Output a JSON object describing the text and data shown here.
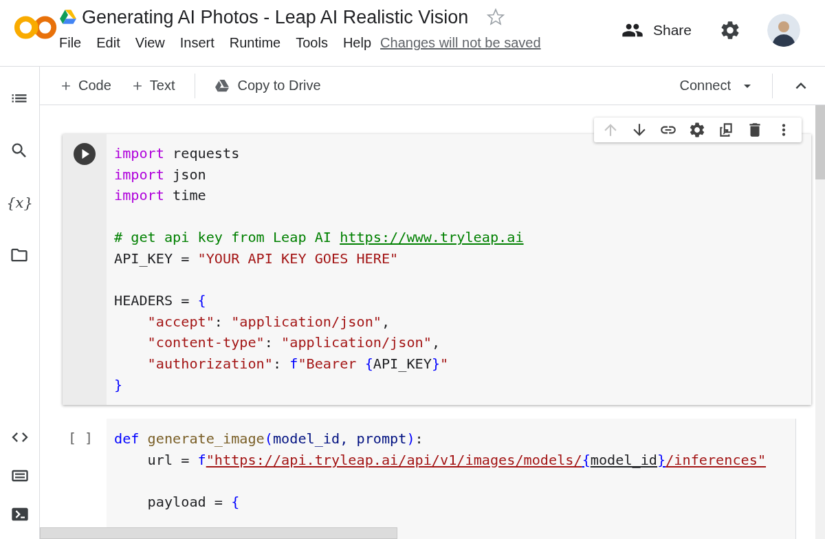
{
  "header": {
    "title": "Generating AI Photos - Leap AI Realistic Vision",
    "starred": false,
    "menu": [
      "File",
      "Edit",
      "View",
      "Insert",
      "Runtime",
      "Tools",
      "Help"
    ],
    "notice": "Changes will not be saved",
    "share": "Share"
  },
  "toolbar": {
    "add_code": "Code",
    "add_text": "Text",
    "copy": "Copy to Drive",
    "connect": "Connect"
  },
  "sidebar": {
    "top": [
      {
        "kind": "toc"
      },
      {
        "kind": "search"
      },
      {
        "kind": "variables",
        "glyph": "{x}"
      },
      {
        "kind": "files"
      }
    ],
    "bottom": [
      {
        "kind": "snippets"
      },
      {
        "kind": "palette"
      },
      {
        "kind": "terminal"
      }
    ]
  },
  "cell_toolbar": [
    {
      "kind": "up",
      "disabled": true
    },
    {
      "kind": "down",
      "disabled": false
    },
    {
      "kind": "link",
      "disabled": false
    },
    {
      "kind": "settings",
      "disabled": false
    },
    {
      "kind": "mirror",
      "disabled": false
    },
    {
      "kind": "delete",
      "disabled": false
    },
    {
      "kind": "more",
      "disabled": false
    }
  ],
  "cells": [
    {
      "focused": true,
      "lines": [
        {
          "tokens": [
            {
              "text": "import",
              "kind": "kw"
            },
            {
              "text": " requests",
              "kind": "plain"
            }
          ]
        },
        {
          "tokens": [
            {
              "text": "import",
              "kind": "kw"
            },
            {
              "text": " json",
              "kind": "plain"
            }
          ]
        },
        {
          "tokens": [
            {
              "text": "import",
              "kind": "kw"
            },
            {
              "text": " time",
              "kind": "plain"
            }
          ]
        },
        {
          "space_before": true,
          "tokens": [
            {
              "text": "# get api key from Leap AI ",
              "kind": "comment"
            },
            {
              "text": "https://www.tryleap.ai",
              "kind": "comment",
              "underlined": true
            }
          ]
        },
        {
          "tokens": [
            {
              "text": "API_KEY = ",
              "kind": "plain"
            },
            {
              "text": "\"YOUR API KEY GOES HERE\"",
              "kind": "str"
            }
          ]
        },
        {
          "space_before": true,
          "tokens": [
            {
              "text": "HEADERS = ",
              "kind": "plain"
            },
            {
              "text": "{",
              "kind": "blue"
            }
          ]
        },
        {
          "tokens": [
            {
              "text": "    \"accept\"",
              "kind": "str"
            },
            {
              "text": ": ",
              "kind": "plain"
            },
            {
              "text": "\"application/json\"",
              "kind": "str"
            },
            {
              "text": ",",
              "kind": "plain"
            }
          ]
        },
        {
          "tokens": [
            {
              "text": "    \"content-type\"",
              "kind": "str"
            },
            {
              "text": ": ",
              "kind": "plain"
            },
            {
              "text": "\"application/json\"",
              "kind": "str"
            },
            {
              "text": ",",
              "kind": "plain"
            }
          ]
        },
        {
          "tokens": [
            {
              "text": "    \"authorization\"",
              "kind": "str"
            },
            {
              "text": ": ",
              "kind": "plain"
            },
            {
              "text": "f",
              "kind": "blue"
            },
            {
              "text": "\"Bearer ",
              "kind": "str"
            },
            {
              "text": "{",
              "kind": "blue"
            },
            {
              "text": "API_KEY",
              "kind": "plain"
            },
            {
              "text": "}",
              "kind": "blue"
            },
            {
              "text": "\"",
              "kind": "str"
            }
          ]
        },
        {
          "tokens": [
            {
              "text": "}",
              "kind": "blue"
            }
          ]
        }
      ]
    },
    {
      "focused": false,
      "prompt": "[ ]",
      "lines": [
        {
          "tokens": [
            {
              "text": "def",
              "kind": "blue"
            },
            {
              "text": " generate_image",
              "kind": "func"
            },
            {
              "text": "(",
              "kind": "blue"
            },
            {
              "text": "model_id, prompt",
              "kind": "param"
            },
            {
              "text": ")",
              "kind": "blue"
            },
            {
              "text": ":",
              "kind": "plain"
            }
          ]
        },
        {
          "tokens": [
            {
              "text": "    url = ",
              "kind": "plain"
            },
            {
              "text": "f",
              "kind": "blue"
            },
            {
              "text": "\"https://api.tryleap.ai/api/v1/images/models/",
              "kind": "str",
              "underlined": true
            },
            {
              "text": "{",
              "kind": "blue",
              "underlined": true
            },
            {
              "text": "model_id",
              "kind": "plain",
              "underlined": true
            },
            {
              "text": "}",
              "kind": "blue",
              "underlined": true
            },
            {
              "text": "/inferences\"",
              "kind": "str",
              "underlined": true
            }
          ]
        },
        {
          "space_before": true,
          "tokens": [
            {
              "text": "    payload = ",
              "kind": "plain"
            },
            {
              "text": "{",
              "kind": "blue"
            }
          ]
        }
      ]
    }
  ]
}
